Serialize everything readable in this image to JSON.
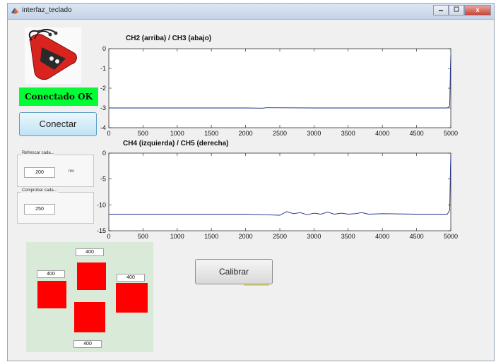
{
  "window": {
    "title": "interfaz_teclado",
    "close_glyph": "x"
  },
  "status": {
    "label": "Conectado OK",
    "color": "#00ff33"
  },
  "buttons": {
    "connect_label": "Conectar",
    "calibrate_label": "Calibrar"
  },
  "refresh": {
    "title": "Refrescar cada...",
    "value": "200",
    "unit": "ms"
  },
  "check": {
    "title": "Comprobar cada...",
    "value": "250"
  },
  "arrows": {
    "up": "400",
    "left": "400",
    "right": "400",
    "down": "400"
  },
  "plots": [
    {
      "title": "CH2 (arriba) / CH3 (abajo)",
      "x_ticks": [
        "0",
        "500",
        "1000",
        "1500",
        "2000",
        "2500",
        "3000",
        "3500",
        "4000",
        "4500",
        "5000"
      ],
      "y_ticks": [
        "0",
        "-1",
        "-2",
        "-3",
        "-4"
      ]
    },
    {
      "title": "CH4 (izquierda) / CH5 (derecha)",
      "x_ticks": [
        "0",
        "500",
        "1000",
        "1500",
        "2000",
        "2500",
        "3000",
        "3500",
        "4000",
        "4500",
        "5000"
      ],
      "y_ticks": [
        "0",
        "-5",
        "-10",
        "-15"
      ]
    }
  ],
  "chart_data": [
    {
      "type": "line",
      "title": "CH2 (arriba) / CH3 (abajo)",
      "xlim": [
        0,
        5000
      ],
      "ylim": [
        -4,
        0
      ],
      "series": [
        {
          "x": [
            0,
            1000,
            2000,
            2250,
            2300,
            3000,
            4000,
            4950,
            4985,
            4995,
            5000
          ],
          "y": [
            -3.0,
            -3.0,
            -3.0,
            -3.01,
            -2.99,
            -3.0,
            -3.0,
            -3.0,
            -2.9,
            -1.0,
            -0.3
          ]
        }
      ]
    },
    {
      "type": "line",
      "title": "CH4 (izquierda) / CH5 (derecha)",
      "xlim": [
        0,
        5000
      ],
      "ylim": [
        -15,
        0
      ],
      "series": [
        {
          "x": [
            0,
            500,
            1000,
            1500,
            2000,
            2250,
            2500,
            2600,
            2700,
            2800,
            2900,
            3000,
            3100,
            3200,
            3300,
            3400,
            3500,
            3600,
            3700,
            3800,
            4000,
            4500,
            4950,
            4985,
            4995,
            5000
          ],
          "y": [
            -11.8,
            -11.8,
            -11.8,
            -11.8,
            -11.8,
            -11.9,
            -12.0,
            -11.3,
            -11.7,
            -11.5,
            -11.9,
            -11.6,
            -11.8,
            -11.4,
            -11.8,
            -11.6,
            -11.8,
            -11.7,
            -11.5,
            -11.8,
            -11.7,
            -11.8,
            -11.8,
            -11.0,
            -3.0,
            -0.5
          ]
        }
      ]
    }
  ]
}
